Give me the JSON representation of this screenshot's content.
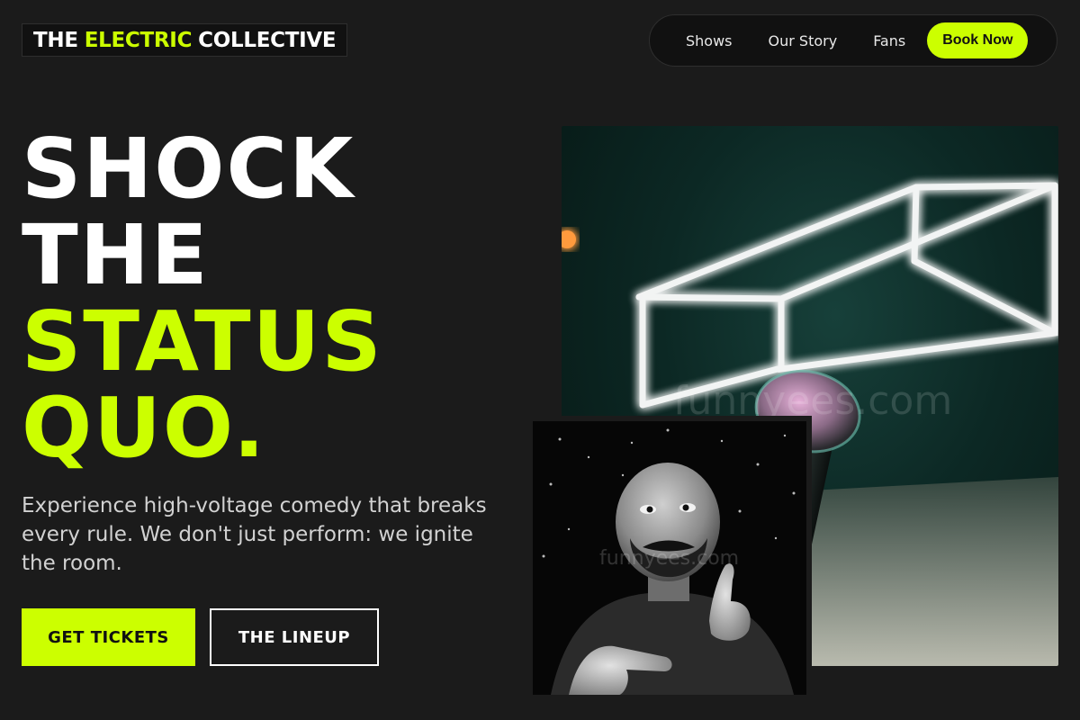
{
  "brand": {
    "word1": "THE",
    "word2": "ELECTRIC",
    "word3": "COLLECTIVE",
    "accent_color": "#ccff00"
  },
  "nav": {
    "links": [
      "Shows",
      "Our Story",
      "Fans"
    ],
    "cta": "Book Now"
  },
  "hero": {
    "line1": "SHOCK",
    "line2": "THE",
    "line3": "STATUS",
    "line4": "QUO.",
    "subtext": "Experience high-voltage comedy that breaks every rule. We don't just perform: we ignite the room.",
    "primary_button": "GET TICKETS",
    "secondary_button": "THE LINEUP"
  },
  "images": {
    "stage_watermark": "funnyees.com",
    "portrait_watermark": "funnyees.com",
    "stage_icon": "neon-cube-microphone-photo",
    "portrait_icon": "comedian-pointing-photo"
  },
  "colors": {
    "background": "#1b1b1b",
    "accent": "#ccff00",
    "text": "#ffffff",
    "muted": "#d2d2d2"
  }
}
